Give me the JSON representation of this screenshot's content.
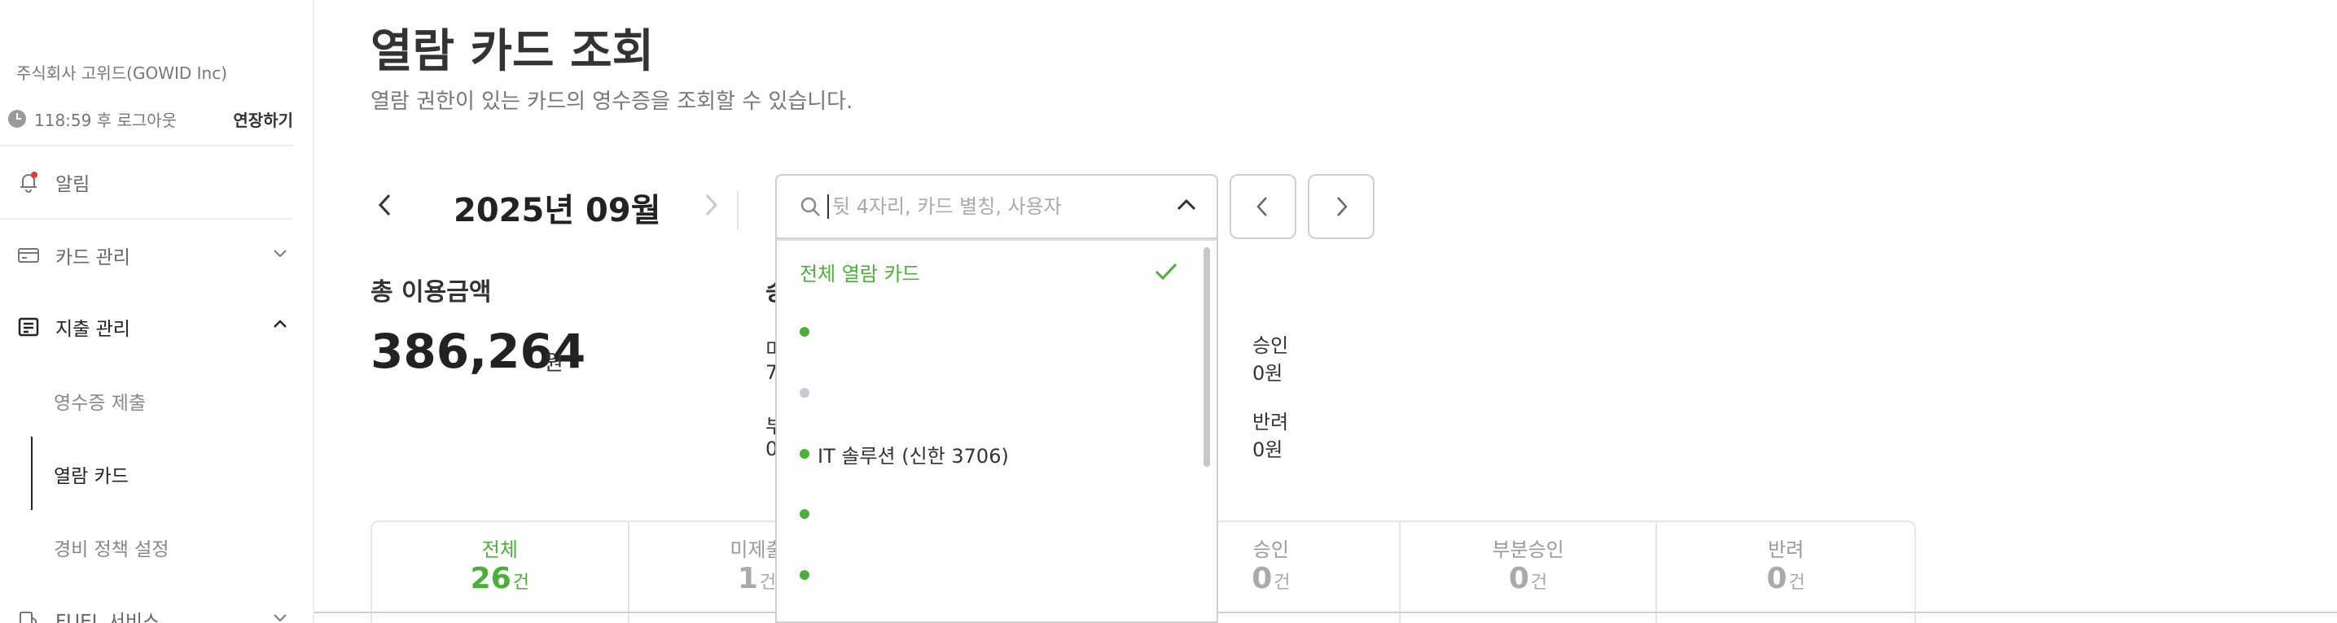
{
  "sidebar": {
    "company": "주식회사 고위드(GOWID Inc)",
    "session_time": "118:59 후 로그아웃",
    "extend_label": "연장하기",
    "nav": {
      "alarm": "알림",
      "card_manage": "카드 관리",
      "expense_manage": "지출 관리",
      "receipt_submit": "영수증 제출",
      "view_card": "열람 카드",
      "policy": "경비 정책 설정",
      "fuel": "FUEL 서비스"
    }
  },
  "main": {
    "title": "열람 카드 조회",
    "description": "열람 권한이 있는 카드의 영수증을 조회할 수 있습니다.",
    "month": "2025년 09월",
    "total_label": "총 이용금액",
    "total_value": "386,264",
    "total_unit": "원",
    "partial_label_frag": "승",
    "stats": {
      "unsubmitted_frag": "미",
      "unsubmitted_value_frag": "7",
      "partial_frag": "부",
      "partial_value_frag": "0",
      "approved_label": "승인",
      "approved_value": "0원",
      "rejected_label": "반려",
      "rejected_value": "0원"
    },
    "tabs": [
      {
        "label": "전체",
        "count": "26",
        "unit": "건"
      },
      {
        "label": "미제출",
        "count": "1",
        "unit": "건"
      },
      {
        "label": "",
        "count": "",
        "unit": ""
      },
      {
        "label": "승인",
        "count": "0",
        "unit": "건"
      },
      {
        "label": "부분승인",
        "count": "0",
        "unit": "건"
      },
      {
        "label": "반려",
        "count": "0",
        "unit": "건"
      }
    ]
  },
  "search": {
    "placeholder": "뒷 4자리, 카드 별칭, 사용자",
    "all_cards": "전체 열람 카드",
    "items": [
      "",
      "",
      "IT 솔루션 (신한 3706)",
      "",
      ""
    ]
  },
  "colors": {
    "accent": "#4caf3a",
    "border": "#cfcfcf",
    "muted": "#999999"
  }
}
